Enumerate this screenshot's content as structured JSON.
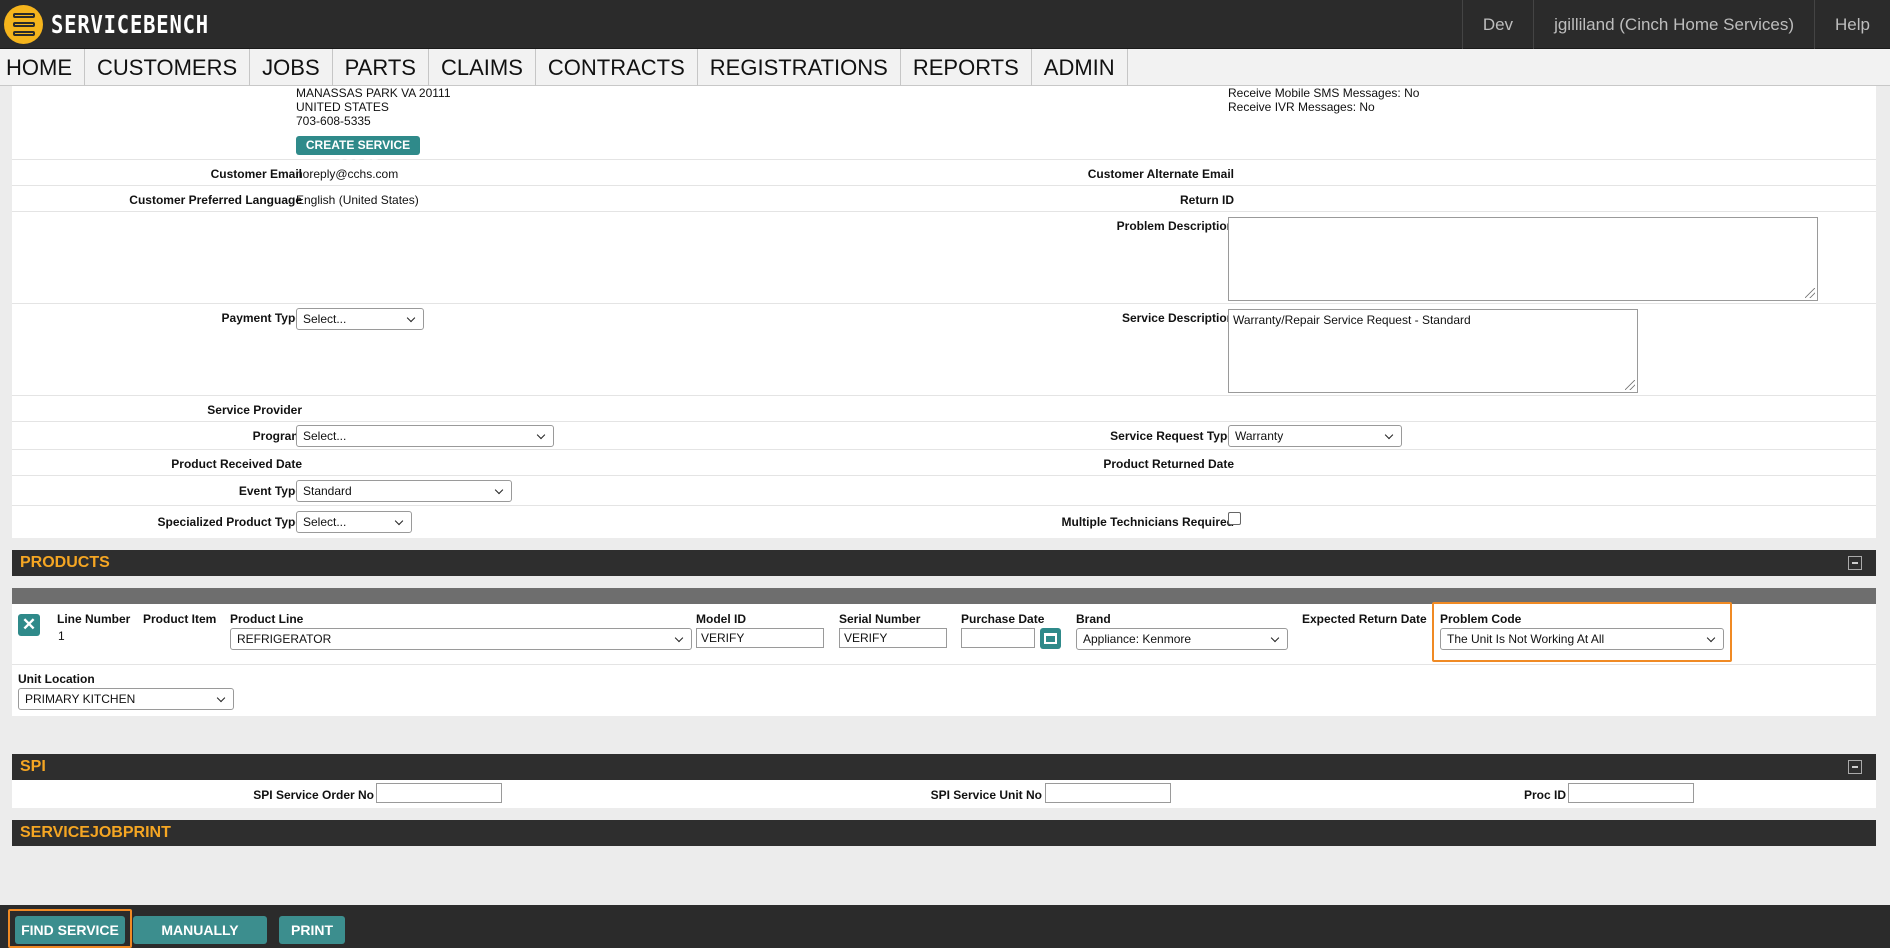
{
  "app": {
    "logo_text": "SERVICEBENCH",
    "env": "Dev",
    "user": "jgilliland (Cinch Home Services)",
    "help": "Help"
  },
  "nav": [
    "HOME",
    "CUSTOMERS",
    "JOBS",
    "PARTS",
    "CLAIMS",
    "CONTRACTS",
    "REGISTRATIONS",
    "REPORTS",
    "ADMIN"
  ],
  "customer": {
    "address_line": "MANASSAS PARK VA 20111",
    "country": "UNITED STATES",
    "phone": "703-608-5335",
    "sms": "Receive Mobile SMS Messages: No",
    "ivr": "Receive IVR Messages: No",
    "create_order_label": "CREATE SERVICE ORDER",
    "email_label": "Customer Email",
    "email": "noreply@cchs.com",
    "alt_email_label": "Customer Alternate Email",
    "language_label": "Customer Preferred Language",
    "language": "English (United States)",
    "return_id_label": "Return ID"
  },
  "service": {
    "problem_desc_label": "Problem Description",
    "problem_desc": "",
    "payment_type_label": "Payment Type",
    "payment_type": "Select...",
    "service_desc_label": "Service Description",
    "service_desc": "Warranty/Repair Service Request - Standard",
    "provider_label": "Service Provider",
    "program_label": "Program",
    "program": "Select...",
    "request_type_label": "Service Request Type",
    "request_type": "Warranty",
    "received_date_label": "Product Received Date",
    "returned_date_label": "Product Returned Date",
    "event_type_label": "Event Type",
    "event_type": "Standard",
    "specialized_label": "Specialized Product Type",
    "specialized": "Select...",
    "multi_tech_label": "Multiple Technicians Required"
  },
  "products": {
    "title": "PRODUCTS",
    "headers": {
      "line_number": "Line Number",
      "product_item": "Product Item",
      "product_line": "Product Line",
      "model_id": "Model ID",
      "serial_number": "Serial Number",
      "purchase_date": "Purchase Date",
      "brand": "Brand",
      "expected_return": "Expected Return Date",
      "problem_code": "Problem Code",
      "unit_location": "Unit Location"
    },
    "row": {
      "line_number": "1",
      "product_line": "REFRIGERATOR",
      "model_id": "VERIFY",
      "serial_number": "VERIFY",
      "purchase_date": "",
      "brand": "Appliance: Kenmore",
      "problem_code": "The Unit Is Not Working At All",
      "unit_location": "PRIMARY KITCHEN"
    }
  },
  "spi": {
    "title": "SPI",
    "order_no_label": "SPI Service Order No",
    "unit_no_label": "SPI Service Unit No",
    "proc_id_label": "Proc ID"
  },
  "servicejobprint": {
    "title": "SERVICEJOBPRINT"
  },
  "footer": {
    "find_service": "FIND SERVICE",
    "manually_assign": "MANUALLY ASSIGN",
    "print": "PRINT"
  }
}
